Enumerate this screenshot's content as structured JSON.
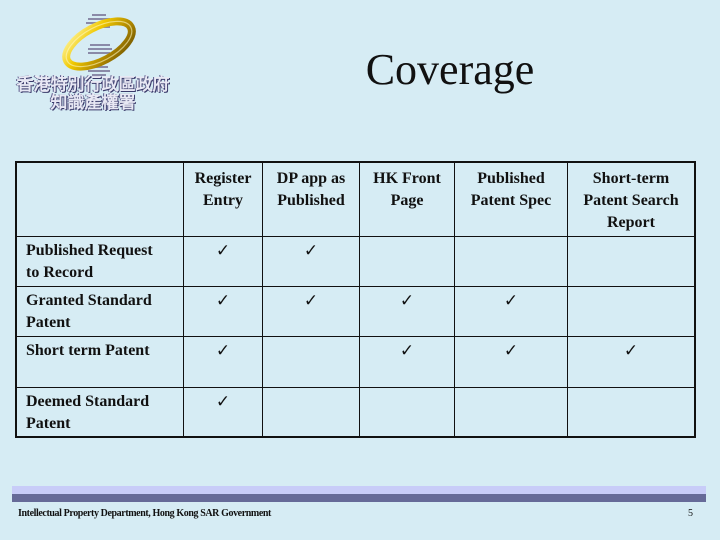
{
  "logo": {
    "line1": "香港特別行政區政府",
    "line2": "知識產權署"
  },
  "title": "Coverage",
  "table": {
    "columns": [
      "",
      "Register Entry",
      "DP app as Published",
      "HK Front Page",
      "Published Patent Spec",
      "Short-term Patent Search Report"
    ],
    "column_lines": [
      [
        ""
      ],
      [
        "Register",
        "Entry"
      ],
      [
        "DP app as",
        "Published"
      ],
      [
        "HK Front",
        "Page"
      ],
      [
        "Published",
        "Patent Spec"
      ],
      [
        "Short-term",
        "Patent Search",
        "Report"
      ]
    ],
    "check_symbol": "✓",
    "rows": [
      {
        "label": "Published Request to Record",
        "label_lines": [
          "Published Request",
          "to Record"
        ],
        "cells": [
          "✓",
          "✓",
          "",
          "",
          ""
        ]
      },
      {
        "label": "Granted Standard Patent",
        "label_lines": [
          "Granted Standard",
          "Patent"
        ],
        "cells": [
          "✓",
          "✓",
          "✓",
          "✓",
          ""
        ]
      },
      {
        "label": "Short term Patent",
        "label_lines": [
          "Short term Patent"
        ],
        "cells": [
          "✓",
          "",
          "✓",
          "✓",
          "✓"
        ]
      },
      {
        "label": "Deemed Standard Patent",
        "label_lines": [
          "Deemed Standard",
          "Patent"
        ],
        "cells": [
          "✓",
          "",
          "",
          "",
          ""
        ]
      }
    ]
  },
  "footer": {
    "text": "Intellectual Property Department, Hong Kong SAR Government",
    "page_number": "5"
  },
  "colors": {
    "background": "#d6ecf4",
    "footer_bar_light": "#c8ccf8",
    "footer_bar_dark": "#666a98",
    "logo_ring": "#d4a800"
  }
}
